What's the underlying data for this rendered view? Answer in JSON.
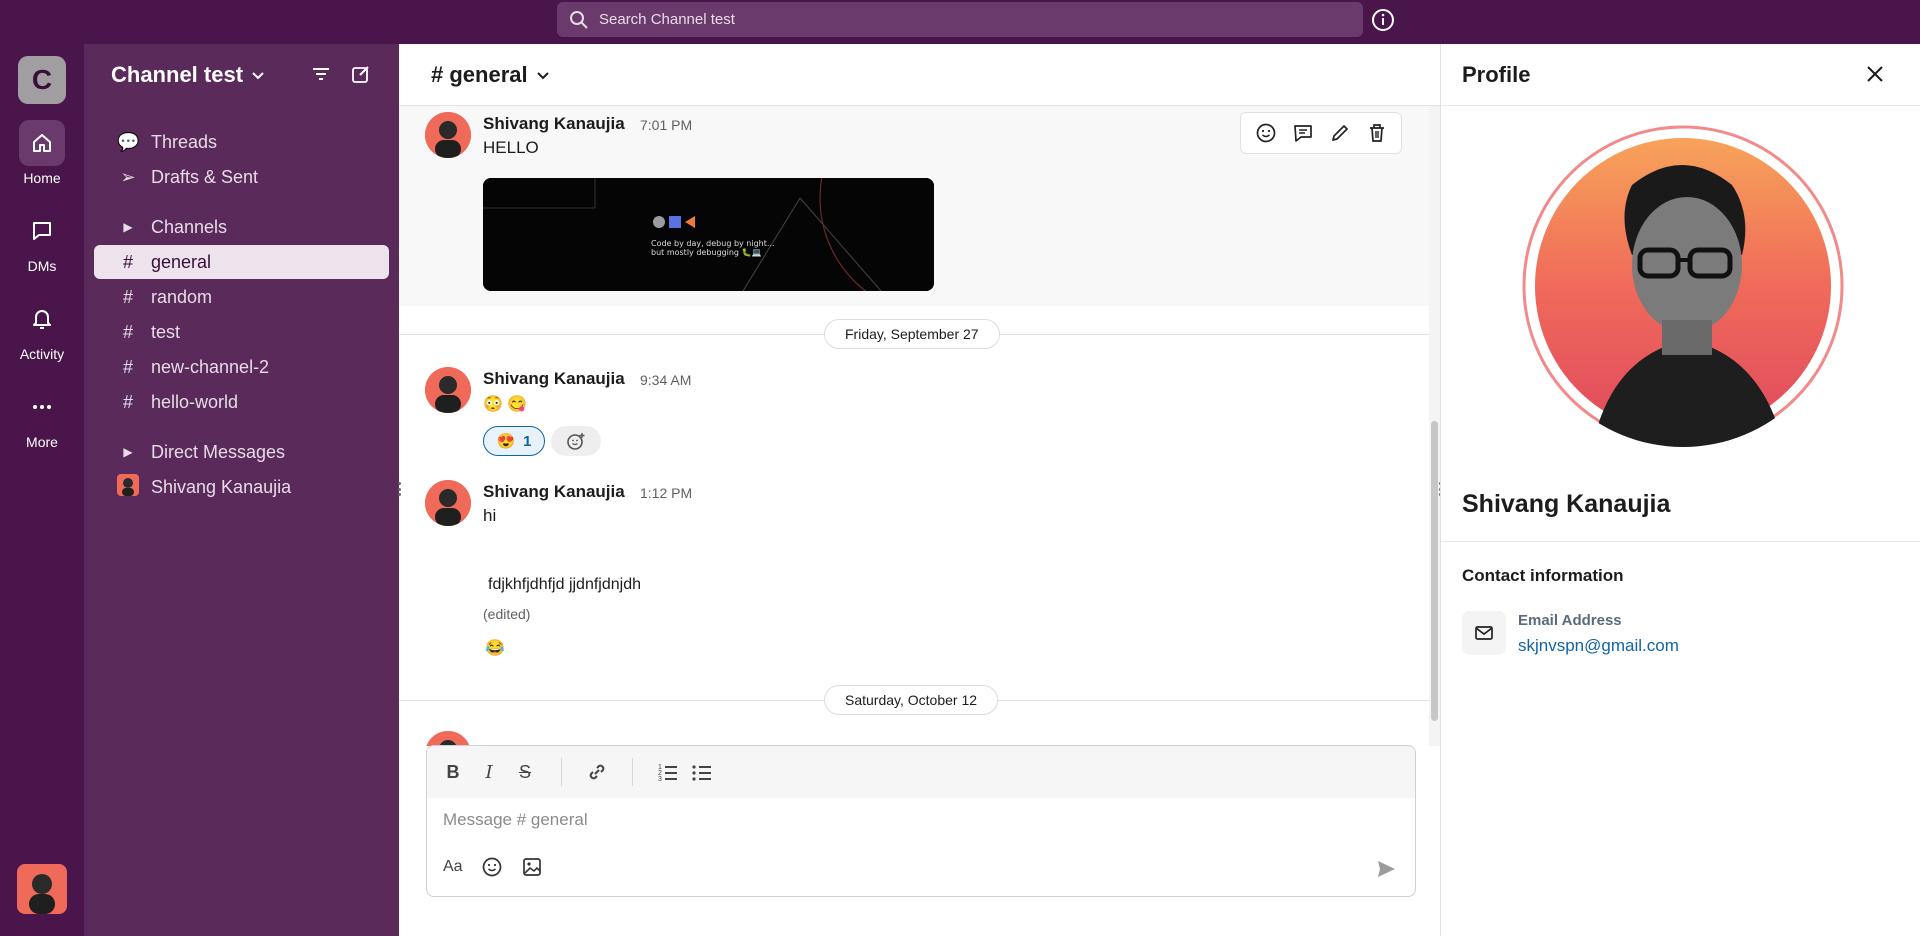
{
  "search": {
    "placeholder": "Search Channel test"
  },
  "rail": {
    "workspace_initial": "C",
    "items": [
      {
        "label": "Home",
        "icon": "home-icon"
      },
      {
        "label": "DMs",
        "icon": "dm-icon"
      },
      {
        "label": "Activity",
        "icon": "bell-icon"
      },
      {
        "label": "More",
        "icon": "more-icon"
      }
    ]
  },
  "sidebar": {
    "workspace_name": "Channel test",
    "threads": "Threads",
    "drafts": "Drafts & Sent",
    "channels_header": "Channels",
    "channels": [
      "general",
      "random",
      "test",
      "new-channel-2",
      "hello-world"
    ],
    "active_channel": "general",
    "dm_header": "Direct Messages",
    "dms": [
      "Shivang Kanaujia"
    ]
  },
  "channel": {
    "title": "# general",
    "messages": [
      {
        "author": "Shivang Kanaujia",
        "time": "7:01 PM",
        "text": "HELLO",
        "embed_text_1": "Code by day, debug by night...",
        "embed_text_2": "but mostly debugging 🐛💻"
      },
      {
        "author": "Shivang Kanaujia",
        "time": "9:34 AM",
        "text": "😳 😋",
        "reaction_emoji": "😍",
        "reaction_count": "1"
      },
      {
        "author": "Shivang Kanaujia",
        "time": "1:12 PM",
        "text": "hi",
        "text2": "fdjkhfjdhfjd  jjdnfjdnjdh",
        "edited": "(edited)",
        "emoji": "😂"
      }
    ],
    "dates": [
      "Friday, September 27",
      "Saturday, October 12"
    ],
    "composer_placeholder": "Message # general"
  },
  "profile": {
    "title": "Profile",
    "name": "Shivang Kanaujia",
    "contact_header": "Contact information",
    "email_label": "Email Address",
    "email": "skjnvspn@gmail.com"
  },
  "colors": {
    "brand": "#4a154b",
    "sidebar": "#5a2a5b",
    "link": "#1264a3"
  }
}
